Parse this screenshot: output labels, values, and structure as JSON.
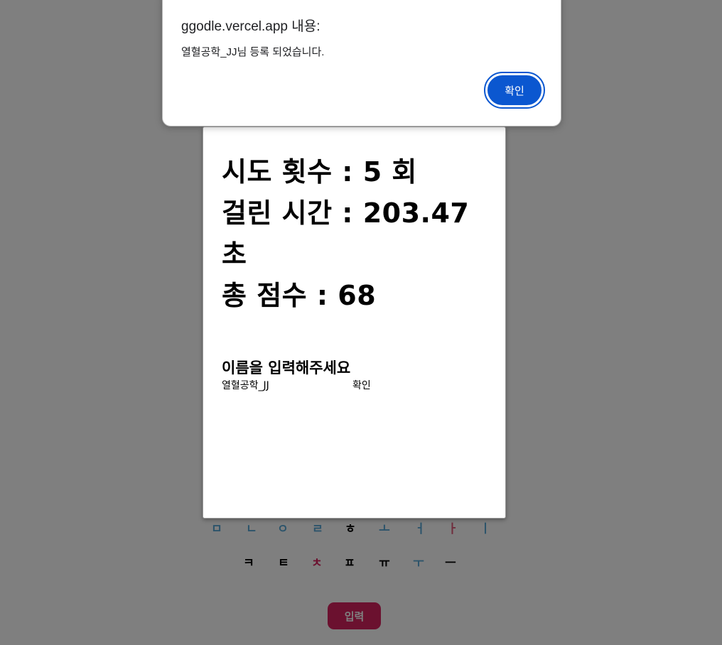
{
  "alert": {
    "title": "ggodle.vercel.app 내용:",
    "message": "열혈공학_JJ님 등록 되었습니다.",
    "ok_label": "확인"
  },
  "result": {
    "attempts": "시도 횟수 : 5 회",
    "elapsed": "걸린 시간 : 203.47",
    "elapsed_unit": "초",
    "score": "총 점수 : 68",
    "name_prompt": "이름을 입력해주세요",
    "name_value": "열혈공학_JJ",
    "confirm_label": "확인"
  },
  "keyboard": {
    "row2": [
      {
        "char": "ㅁ",
        "color": "#5aa9d6"
      },
      {
        "char": "ㄴ",
        "color": "#5aa9d6"
      },
      {
        "char": "ㅇ",
        "color": "#5aa9d6"
      },
      {
        "char": "ㄹ",
        "color": "#5aa9d6"
      },
      {
        "char": "ㅎ",
        "color": "#000000"
      },
      {
        "char": "ㅗ",
        "color": "#5aa9d6"
      },
      {
        "char": "ㅓ",
        "color": "#5aa9d6"
      },
      {
        "char": "ㅏ",
        "color": "#e05a7a"
      },
      {
        "char": "ㅣ",
        "color": "#5aa9d6"
      }
    ],
    "row3": [
      {
        "char": "ㅋ",
        "color": "#000000"
      },
      {
        "char": "ㅌ",
        "color": "#000000"
      },
      {
        "char": "ㅊ",
        "color": "#d7235f"
      },
      {
        "char": "ㅍ",
        "color": "#000000"
      },
      {
        "char": "ㅠ",
        "color": "#000000"
      },
      {
        "char": "ㅜ",
        "color": "#5aa9d6"
      },
      {
        "char": "ㅡ",
        "color": "#000000"
      }
    ],
    "submit_label": "입력"
  }
}
